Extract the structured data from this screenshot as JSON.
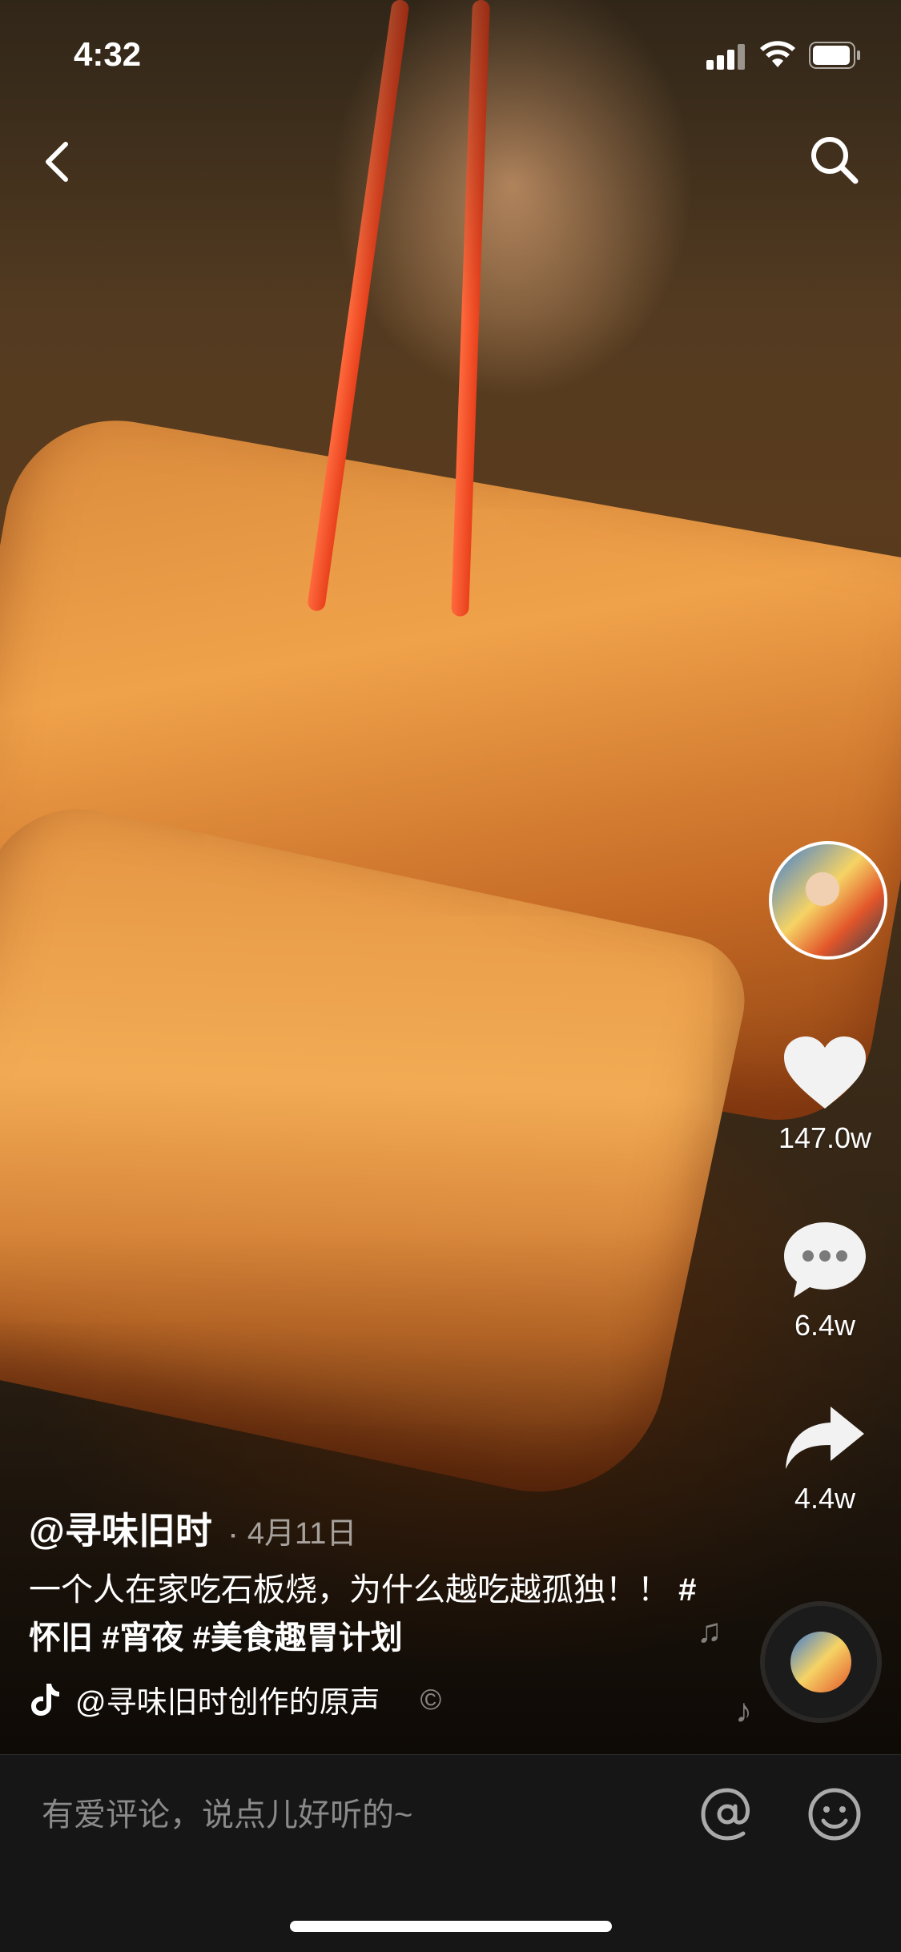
{
  "status_bar": {
    "time": "4:32"
  },
  "video": {
    "author_handle": "@寻味旧时",
    "date": "4月11日",
    "caption_text": "一个人在家吃石板烧，为什么越吃越孤独！！",
    "hashtags": [
      "#怀旧",
      "#宵夜",
      "#美食趣胃计划"
    ],
    "music": "@寻味旧时创作的原声"
  },
  "actions": {
    "likes": "147.0w",
    "comments": "6.4w",
    "shares": "4.4w"
  },
  "comment_bar": {
    "placeholder": "有爱评论，说点儿好听的~"
  },
  "icons": {
    "back": "back-icon",
    "search": "search-icon",
    "like": "heart-icon",
    "comment": "comment-icon",
    "share": "share-icon",
    "at": "at-icon",
    "emoji": "emoji-icon",
    "music": "tiktok-note-icon"
  }
}
